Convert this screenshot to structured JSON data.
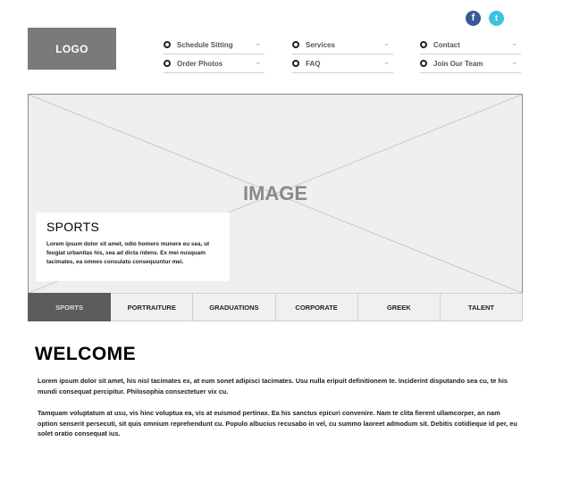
{
  "social": {
    "facebook_glyph": "f",
    "twitter_glyph": "t",
    "facebook_color": "#3b5998",
    "twitter_color": "#3cc4dd"
  },
  "logo": {
    "label": "LOGO"
  },
  "nav": {
    "items": [
      {
        "label": "Schedule Sitting"
      },
      {
        "label": "Order Photos"
      },
      {
        "label": "Services"
      },
      {
        "label": "FAQ"
      },
      {
        "label": "Contact"
      },
      {
        "label": "Join Our Team"
      }
    ],
    "chevron_glyph": "⌄"
  },
  "hero": {
    "placeholder_label": "IMAGE",
    "caption": {
      "title": "SPORTS",
      "text": "Lorem ipsum dolor sit amet, odio homero munere eu sea, ut feugiat urbanitas his, sea ad dicta ridens. Ex mei nusquam tacimates, ea omnes consulatu consequuntur mei."
    }
  },
  "tabs": [
    {
      "label": "SPORTS",
      "active": true
    },
    {
      "label": "PORTRAITURE",
      "active": false
    },
    {
      "label": "GRADUATIONS",
      "active": false
    },
    {
      "label": "CORPORATE",
      "active": false
    },
    {
      "label": "GREEK",
      "active": false
    },
    {
      "label": "TALENT",
      "active": false
    }
  ],
  "welcome": {
    "title": "WELCOME",
    "paragraphs": [
      "Lorem ipsum dolor sit amet, his nisl tacimates ex, at eum sonet adipisci tacimates. Usu nulla eripuit definitionem te. Inciderint disputando sea cu, te his mundi consequat percipitur. Philosophia consectetuer vix cu.",
      "Tamquam voluptatum at usu, vis hinc voluptua ea, vis at euismod pertinax. Ea his sanctus epicuri convenire. Nam te clita fierent ullamcorper, an nam option senserit persecuti, sit quis omnium reprehendunt cu. Populo albucius recusabo in vel, cu summo laoreet admodum sit. Debitis cotidieque id per, eu solet oratio consequat ius."
    ]
  }
}
